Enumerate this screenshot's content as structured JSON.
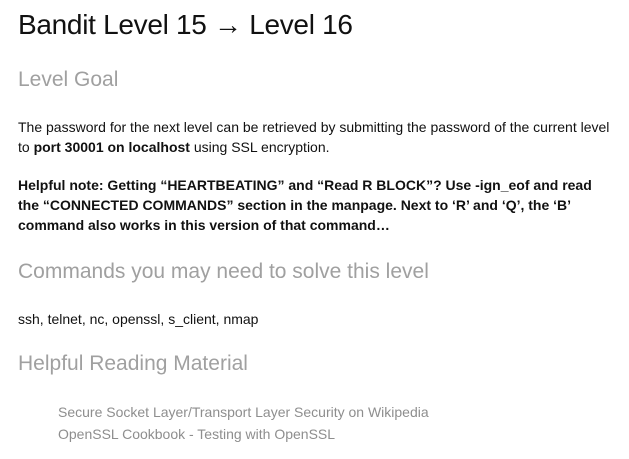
{
  "title": "Bandit Level 15 → Level 16",
  "level_goal": {
    "heading": "Level Goal",
    "text_before": "The password for the next level can be retrieved by submitting the password of the current level to ",
    "text_strong": "port 30001 on localhost",
    "text_after": " using SSL encryption.",
    "helpful_note": "Helpful note: Getting “HEARTBEATING” and “Read R BLOCK”? Use -ign_eof and read the “CONNECTED COMMANDS” section in the manpage. Next to ‘R’ and ‘Q’, the ‘B’ command also works in this version of that command…"
  },
  "commands": {
    "heading": "Commands you may need to solve this level",
    "list": "ssh, telnet, nc, openssl, s_client, nmap"
  },
  "reading": {
    "heading": "Helpful Reading Material",
    "links": [
      "Secure Socket Layer/Transport Layer Security on Wikipedia",
      "OpenSSL Cookbook - Testing with OpenSSL"
    ]
  }
}
